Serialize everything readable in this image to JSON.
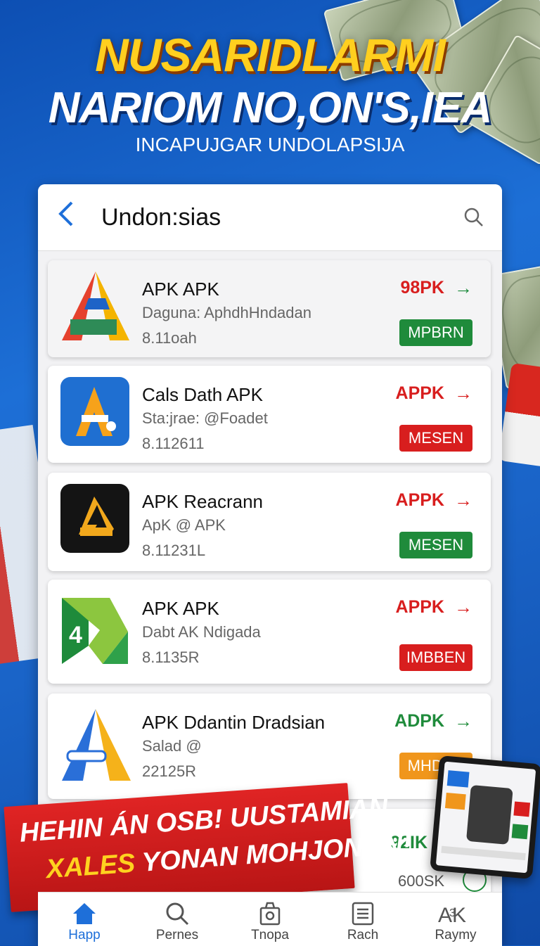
{
  "hero": {
    "line1": "NUSARIDLARMI",
    "line2": "NARIOM NO,ON'S,IEA",
    "line3": "INCAPUJGAR UNDOLAPSIJA"
  },
  "topbar": {
    "title": "Undon:sias",
    "back_icon": "chevron-left-icon",
    "search_icon": "search-icon"
  },
  "apps": [
    {
      "name": "APK APK",
      "subtitle": "Daguna: AphdhHndadan",
      "version": "8.11oah",
      "price": "98PK",
      "price_color": "#d81e1e",
      "arrow_color": "#1a8a3a",
      "button": "MPBRN",
      "button_color": "#1f8b3b"
    },
    {
      "name": "Cals Dath APK",
      "subtitle": "Sta:jrae: @Foadet",
      "version": "8.112611",
      "price": "APPK",
      "price_color": "#d81e1e",
      "arrow_color": "#d81e1e",
      "button": "MESEN",
      "button_color": "#d81e1e"
    },
    {
      "name": "APK Reacrann",
      "subtitle": "ApK @ APK",
      "version": "8.11231L",
      "price": "APPK",
      "price_color": "#d81e1e",
      "arrow_color": "#d81e1e",
      "button": "MESEN",
      "button_color": "#1f8b3b"
    },
    {
      "name": "APK APK",
      "subtitle": "Dabt AK Ndigada",
      "version": "8.1135R",
      "price": "APPK",
      "price_color": "#d81e1e",
      "arrow_color": "#d81e1e",
      "button": "IMBBEN",
      "button_color": "#d81e1e"
    },
    {
      "name": "APK Ddantin Dradsian",
      "subtitle": "Salad @",
      "version": "22125R",
      "price": "ADPK",
      "price_color": "#1f8b3b",
      "arrow_color": "#1f8b3b",
      "button": "MHDEN",
      "button_color": "#f0961c"
    },
    {
      "name": "",
      "subtitle": "",
      "version": "600SK",
      "price": "92IK",
      "price_color": "#1f8b3b",
      "arrow_color": "#1f8b3b",
      "button": "",
      "button_color": ""
    }
  ],
  "promo": {
    "line1": "HEHIN ÁN OSB! UUSTAMIAN",
    "line2_highlight": "XALES",
    "line2_rest": " YONAN MOHJONON!"
  },
  "nav": [
    {
      "label": "Happ",
      "icon": "home-icon",
      "active": true
    },
    {
      "label": "Pernes",
      "icon": "search-icon",
      "active": false
    },
    {
      "label": "Tnopa",
      "icon": "bag-icon",
      "active": false
    },
    {
      "label": "Rach",
      "icon": "list-icon",
      "active": false
    },
    {
      "label": "Raymy",
      "icon": "apk-icon",
      "active": false
    }
  ],
  "colors": {
    "accent": "#1e6fd9",
    "red": "#d81e1e",
    "green": "#1f8b3b",
    "orange": "#f0961c",
    "yellow": "#ffcf1f"
  }
}
